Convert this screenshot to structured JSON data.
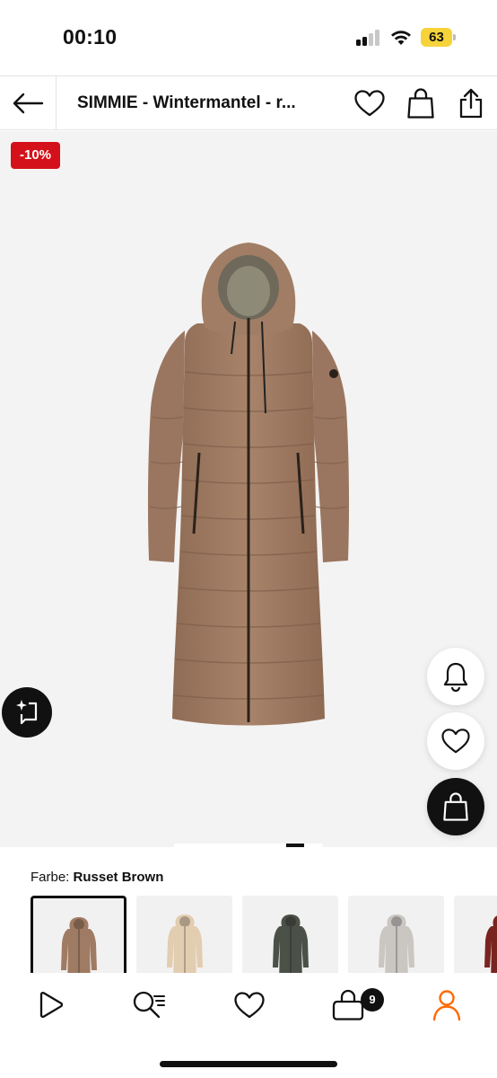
{
  "status_bar": {
    "time": "00:10",
    "battery_level": "63",
    "signal_bars": 2,
    "signal_bars_total": 4,
    "colors": {
      "battery": "#f6d33b"
    }
  },
  "header": {
    "title": "SIMMIE - Wintermantel - r...",
    "icons": [
      "back-arrow-icon",
      "heart-icon",
      "bag-icon",
      "share-icon"
    ]
  },
  "product": {
    "discount_badge": "-10%",
    "colors": {
      "badge": "#d4111a",
      "background": "#f4f3f3",
      "coat": "#a07b63"
    },
    "image_count": 8,
    "image_index": 7,
    "actions": [
      "bell-icon",
      "heart-icon",
      "add-to-bag-icon"
    ]
  },
  "color_selector": {
    "label": "Farbe:",
    "selected_color": "Russet Brown",
    "swatches": [
      {
        "color": "#a07b63",
        "selected": true
      },
      {
        "color": "#e2cdb0",
        "selected": false
      },
      {
        "color": "#4c5148",
        "selected": false
      },
      {
        "color": "#cac6c2",
        "selected": false
      },
      {
        "color": "#7a2420",
        "selected": false
      }
    ]
  },
  "bottom_nav": {
    "items": [
      "discover-icon",
      "search-icon",
      "wishlist-icon",
      "cart-icon",
      "profile-icon"
    ],
    "cart_count": "9",
    "colors": {
      "active": "#ff6900"
    }
  }
}
